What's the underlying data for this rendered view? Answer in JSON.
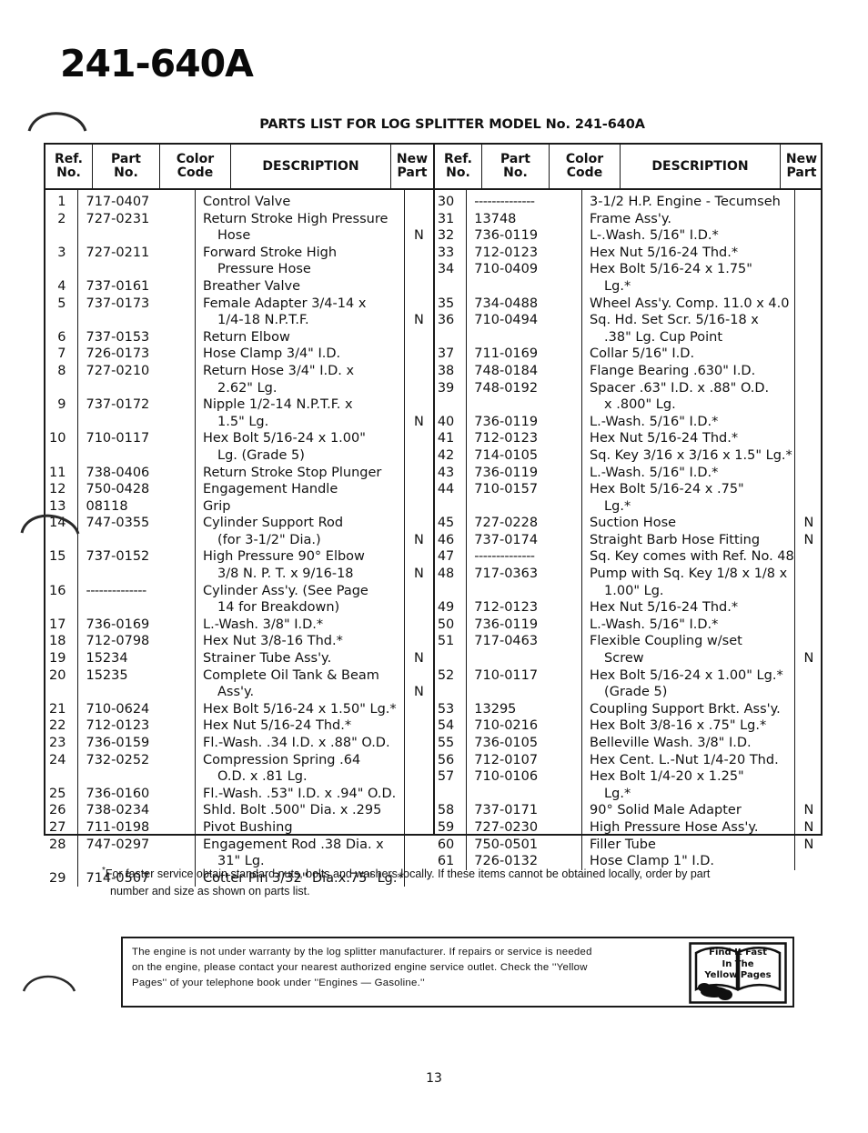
{
  "document": {
    "model_title": "241-640A",
    "list_heading": "PARTS LIST FOR LOG SPLITTER MODEL No. 241-640A",
    "page_number": "13"
  },
  "table": {
    "headers": {
      "ref_no_l1": "Ref.",
      "ref_no_l2": "No.",
      "part_no_l1": "Part",
      "part_no_l2": "No.",
      "color_code_l1": "Color",
      "color_code_l2": "Code",
      "description": "DESCRIPTION",
      "new_part_l1": "New",
      "new_part_l2": "Part"
    },
    "left_rows": [
      {
        "ref": "1",
        "part": "717-0407",
        "color": "",
        "desc": "Control Valve",
        "new": ""
      },
      {
        "ref": "2",
        "part": "727-0231",
        "color": "",
        "desc": "Return Stroke High Pressure",
        "new": ""
      },
      {
        "ref": "",
        "part": "",
        "color": "",
        "desc": "Hose",
        "cont": true,
        "new": "N"
      },
      {
        "ref": "3",
        "part": "727-0211",
        "color": "",
        "desc": "Forward Stroke High",
        "new": ""
      },
      {
        "ref": "",
        "part": "",
        "color": "",
        "desc": "Pressure Hose",
        "cont": true,
        "new": ""
      },
      {
        "ref": "4",
        "part": "737-0161",
        "color": "",
        "desc": "Breather Valve",
        "new": ""
      },
      {
        "ref": "5",
        "part": "737-0173",
        "color": "",
        "desc": "Female Adapter 3/4-14 x",
        "new": ""
      },
      {
        "ref": "",
        "part": "",
        "color": "",
        "desc": "1/4-18 N.P.T.F.",
        "cont": true,
        "new": "N"
      },
      {
        "ref": "6",
        "part": "737-0153",
        "color": "",
        "desc": "Return Elbow",
        "new": ""
      },
      {
        "ref": "7",
        "part": "726-0173",
        "color": "",
        "desc": "Hose Clamp 3/4\" I.D.",
        "new": ""
      },
      {
        "ref": "8",
        "part": "727-0210",
        "color": "",
        "desc": "Return Hose 3/4\" I.D. x",
        "new": ""
      },
      {
        "ref": "",
        "part": "",
        "color": "",
        "desc": "2.62\" Lg.",
        "cont": true,
        "new": ""
      },
      {
        "ref": "9",
        "part": "737-0172",
        "color": "",
        "desc": "Nipple 1/2-14 N.P.T.F. x",
        "new": ""
      },
      {
        "ref": "",
        "part": "",
        "color": "",
        "desc": "1.5\" Lg.",
        "cont": true,
        "new": "N"
      },
      {
        "ref": "10",
        "part": "710-0117",
        "color": "",
        "desc": "Hex Bolt 5/16-24 x 1.00\"",
        "new": ""
      },
      {
        "ref": "",
        "part": "",
        "color": "",
        "desc": "Lg. (Grade 5)",
        "cont": true,
        "new": ""
      },
      {
        "ref": "11",
        "part": "738-0406",
        "color": "",
        "desc": "Return Stroke Stop Plunger",
        "new": ""
      },
      {
        "ref": "12",
        "part": "750-0428",
        "color": "",
        "desc": "Engagement Handle",
        "new": ""
      },
      {
        "ref": "13",
        "part": "08118",
        "color": "",
        "desc": "Grip",
        "new": ""
      },
      {
        "ref": "14",
        "part": "747-0355",
        "color": "",
        "desc": "Cylinder Support Rod",
        "new": ""
      },
      {
        "ref": "",
        "part": "",
        "color": "",
        "desc": "(for 3-1/2\" Dia.)",
        "cont": true,
        "new": "N"
      },
      {
        "ref": "15",
        "part": "737-0152",
        "color": "",
        "desc": "High Pressure 90° Elbow",
        "new": ""
      },
      {
        "ref": "",
        "part": "",
        "color": "",
        "desc": "3/8 N. P. T. x 9/16-18",
        "cont": true,
        "new": "N"
      },
      {
        "ref": "16",
        "part": "--------------",
        "color": "",
        "desc": "Cylinder Ass'y. (See Page",
        "new": ""
      },
      {
        "ref": "",
        "part": "",
        "color": "",
        "desc": "14 for Breakdown)",
        "cont": true,
        "new": ""
      },
      {
        "ref": "17",
        "part": "736-0169",
        "color": "",
        "desc": "L.-Wash. 3/8\" I.D.*",
        "new": ""
      },
      {
        "ref": "18",
        "part": "712-0798",
        "color": "",
        "desc": "Hex Nut 3/8-16 Thd.*",
        "new": ""
      },
      {
        "ref": "19",
        "part": "15234",
        "color": "",
        "desc": "Strainer Tube Ass'y.",
        "new": "N"
      },
      {
        "ref": "20",
        "part": "15235",
        "color": "",
        "desc": "Complete Oil Tank & Beam",
        "new": ""
      },
      {
        "ref": "",
        "part": "",
        "color": "",
        "desc": "Ass'y.",
        "cont": true,
        "new": "N"
      },
      {
        "ref": "21",
        "part": "710-0624",
        "color": "",
        "desc": "Hex Bolt 5/16-24 x 1.50\" Lg.*",
        "new": ""
      },
      {
        "ref": "22",
        "part": "712-0123",
        "color": "",
        "desc": "Hex Nut 5/16-24 Thd.*",
        "new": ""
      },
      {
        "ref": "23",
        "part": "736-0159",
        "color": "",
        "desc": "Fl.-Wash. .34 I.D. x .88\" O.D.",
        "new": ""
      },
      {
        "ref": "24",
        "part": "732-0252",
        "color": "",
        "desc": "Compression Spring .64",
        "new": ""
      },
      {
        "ref": "",
        "part": "",
        "color": "",
        "desc": "O.D. x .81 Lg.",
        "cont": true,
        "new": ""
      },
      {
        "ref": "25",
        "part": "736-0160",
        "color": "",
        "desc": "Fl.-Wash. .53\" I.D. x .94\" O.D.",
        "new": ""
      },
      {
        "ref": "26",
        "part": "738-0234",
        "color": "",
        "desc": "Shld. Bolt .500\" Dia. x .295",
        "new": ""
      },
      {
        "ref": "27",
        "part": "711-0198",
        "color": "",
        "desc": "Pivot Bushing",
        "new": ""
      },
      {
        "ref": "28",
        "part": "747-0297",
        "color": "",
        "desc": "Engagement Rod .38 Dia. x",
        "new": ""
      },
      {
        "ref": "",
        "part": "",
        "color": "",
        "desc": "31\" Lg.",
        "cont": true,
        "new": ""
      },
      {
        "ref": "29",
        "part": "714-0507",
        "color": "",
        "desc": "Cotter Pin 3/32\" Dia.x.75\" Lg.*",
        "new": ""
      }
    ],
    "right_rows": [
      {
        "ref": "30",
        "part": "--------------",
        "color": "",
        "desc": "3-1/2 H.P. Engine - Tecumseh",
        "new": ""
      },
      {
        "ref": "31",
        "part": "13748",
        "color": "",
        "desc": "Frame Ass'y.",
        "new": ""
      },
      {
        "ref": "32",
        "part": "736-0119",
        "color": "",
        "desc": "L-.Wash. 5/16\" I.D.*",
        "new": ""
      },
      {
        "ref": "33",
        "part": "712-0123",
        "color": "",
        "desc": "Hex Nut 5/16-24 Thd.*",
        "new": ""
      },
      {
        "ref": "34",
        "part": "710-0409",
        "color": "",
        "desc": "Hex Bolt 5/16-24 x 1.75\"",
        "new": ""
      },
      {
        "ref": "",
        "part": "",
        "color": "",
        "desc": "Lg.*",
        "cont": true,
        "new": ""
      },
      {
        "ref": "35",
        "part": "734-0488",
        "color": "",
        "desc": "Wheel Ass'y. Comp. 11.0 x 4.0",
        "new": ""
      },
      {
        "ref": "36",
        "part": "710-0494",
        "color": "",
        "desc": "Sq. Hd. Set Scr. 5/16-18 x",
        "new": ""
      },
      {
        "ref": "",
        "part": "",
        "color": "",
        "desc": ".38\" Lg. Cup Point",
        "cont": true,
        "new": ""
      },
      {
        "ref": "37",
        "part": "711-0169",
        "color": "",
        "desc": "Collar 5/16\" I.D.",
        "new": ""
      },
      {
        "ref": "38",
        "part": "748-0184",
        "color": "",
        "desc": "Flange Bearing .630\" I.D.",
        "new": ""
      },
      {
        "ref": "39",
        "part": "748-0192",
        "color": "",
        "desc": "Spacer .63\" I.D. x .88\" O.D.",
        "new": ""
      },
      {
        "ref": "",
        "part": "",
        "color": "",
        "desc": "x .800\" Lg.",
        "cont": true,
        "new": ""
      },
      {
        "ref": "40",
        "part": "736-0119",
        "color": "",
        "desc": "L.-Wash. 5/16\" I.D.*",
        "new": ""
      },
      {
        "ref": "41",
        "part": "712-0123",
        "color": "",
        "desc": "Hex Nut 5/16-24 Thd.*",
        "new": ""
      },
      {
        "ref": "42",
        "part": "714-0105",
        "color": "",
        "desc": "Sq. Key 3/16 x 3/16 x 1.5\" Lg.*",
        "new": ""
      },
      {
        "ref": "43",
        "part": "736-0119",
        "color": "",
        "desc": "L.-Wash. 5/16\" I.D.*",
        "new": ""
      },
      {
        "ref": "44",
        "part": "710-0157",
        "color": "",
        "desc": "Hex Bolt 5/16-24 x .75\"",
        "new": ""
      },
      {
        "ref": "",
        "part": "",
        "color": "",
        "desc": "Lg.*",
        "cont": true,
        "new": ""
      },
      {
        "ref": "45",
        "part": "727-0228",
        "color": "",
        "desc": "Suction Hose",
        "new": "N"
      },
      {
        "ref": "46",
        "part": "737-0174",
        "color": "",
        "desc": "Straight Barb Hose Fitting",
        "new": "N"
      },
      {
        "ref": "47",
        "part": "--------------",
        "color": "",
        "desc": "Sq. Key comes with Ref. No. 48",
        "new": ""
      },
      {
        "ref": "48",
        "part": "717-0363",
        "color": "",
        "desc": "Pump with Sq. Key 1/8 x 1/8 x",
        "new": ""
      },
      {
        "ref": "",
        "part": "",
        "color": "",
        "desc": "1.00\" Lg.",
        "cont": true,
        "new": ""
      },
      {
        "ref": "49",
        "part": "712-0123",
        "color": "",
        "desc": "Hex Nut 5/16-24 Thd.*",
        "new": ""
      },
      {
        "ref": "50",
        "part": "736-0119",
        "color": "",
        "desc": "L.-Wash. 5/16\" I.D.*",
        "new": ""
      },
      {
        "ref": "51",
        "part": "717-0463",
        "color": "",
        "desc": "Flexible Coupling w/set",
        "new": ""
      },
      {
        "ref": "",
        "part": "",
        "color": "",
        "desc": "Screw",
        "cont": true,
        "new": "N"
      },
      {
        "ref": "52",
        "part": "710-0117",
        "color": "",
        "desc": "Hex Bolt 5/16-24 x 1.00\" Lg.*",
        "new": ""
      },
      {
        "ref": "",
        "part": "",
        "color": "",
        "desc": "(Grade 5)",
        "cont": true,
        "new": ""
      },
      {
        "ref": "53",
        "part": "13295",
        "color": "",
        "desc": "Coupling Support Brkt. Ass'y.",
        "new": ""
      },
      {
        "ref": "54",
        "part": "710-0216",
        "color": "",
        "desc": "Hex Bolt 3/8-16 x .75\" Lg.*",
        "new": ""
      },
      {
        "ref": "55",
        "part": "736-0105",
        "color": "",
        "desc": "Belleville Wash. 3/8\" I.D.",
        "new": ""
      },
      {
        "ref": "56",
        "part": "712-0107",
        "color": "",
        "desc": "Hex Cent. L.-Nut 1/4-20 Thd.",
        "new": ""
      },
      {
        "ref": "57",
        "part": "710-0106",
        "color": "",
        "desc": "Hex Bolt 1/4-20 x 1.25\"",
        "new": ""
      },
      {
        "ref": "",
        "part": "",
        "color": "",
        "desc": "Lg.*",
        "cont": true,
        "new": ""
      },
      {
        "ref": "58",
        "part": "737-0171",
        "color": "",
        "desc": "90° Solid Male Adapter",
        "new": "N"
      },
      {
        "ref": "59",
        "part": "727-0230",
        "color": "",
        "desc": "High Pressure Hose Ass'y.",
        "new": "N"
      },
      {
        "ref": "60",
        "part": "750-0501",
        "color": "",
        "desc": "Filler Tube",
        "new": "N"
      },
      {
        "ref": "61",
        "part": "726-0132",
        "color": "",
        "desc": "Hose Clamp 1\" I.D.",
        "new": ""
      }
    ]
  },
  "footnote": {
    "star": "*",
    "line1": "For faster service obtain standard nuts, bolts and washers locally. If these items cannot be obtained locally, order by part",
    "line2": "number and size as shown on parts list."
  },
  "engine_notice": {
    "line1": "The engine is not under warranty by the log splitter manufacturer. If repairs or service is needed",
    "line2": "on the engine, please contact your nearest authorized engine service outlet. Check the ''Yellow",
    "line3": "Pages'' of your telephone book under ''Engines — Gasoline.''",
    "emblem_line1": "Find It Fast",
    "emblem_line2": "In The",
    "emblem_line3": "Yellow Pages"
  }
}
